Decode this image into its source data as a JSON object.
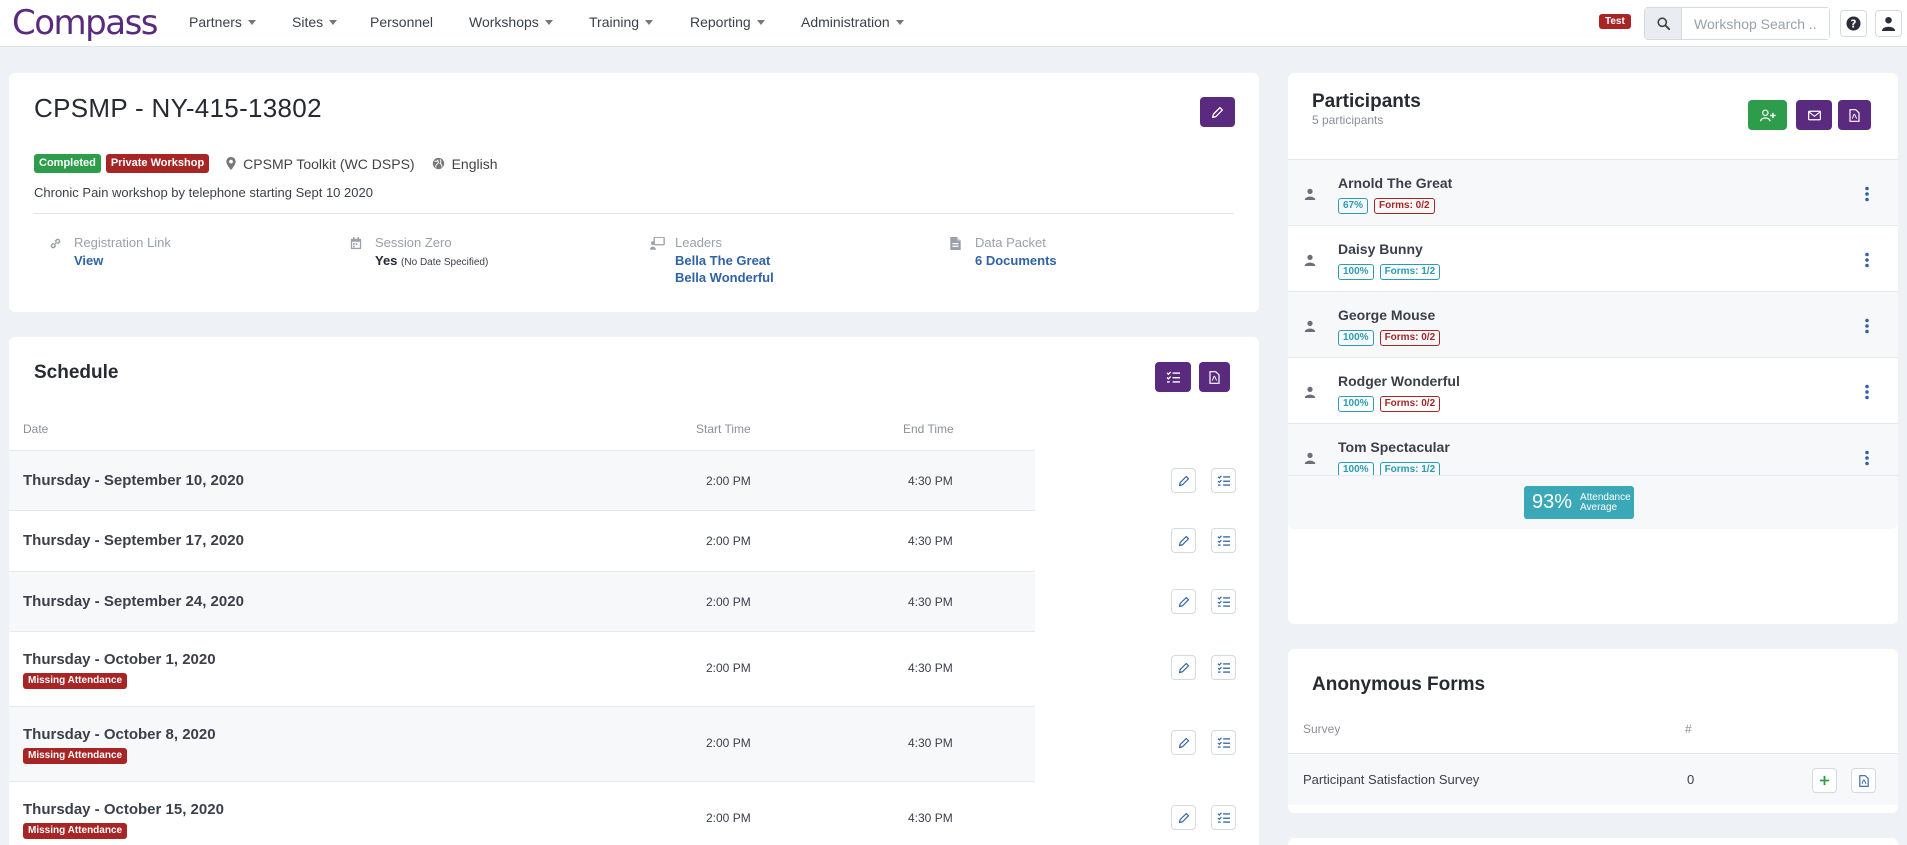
{
  "header": {
    "logo": "Compass",
    "nav": [
      {
        "label": "Partners",
        "dropdown": true
      },
      {
        "label": "Sites",
        "dropdown": true
      },
      {
        "label": "Personnel",
        "dropdown": false
      },
      {
        "label": "Workshops",
        "dropdown": true
      },
      {
        "label": "Training",
        "dropdown": true
      },
      {
        "label": "Reporting",
        "dropdown": true
      },
      {
        "label": "Administration",
        "dropdown": true
      }
    ],
    "env_badge": "Test",
    "search_placeholder": "Workshop Search ..."
  },
  "workshop": {
    "title": "CPSMP - NY-415-13802",
    "status": "Completed",
    "type_badge": "Private Workshop",
    "location": "CPSMP Toolkit (WC DSPS)",
    "language": "English",
    "description": "Chronic Pain workshop by telephone starting Sept 10 2020",
    "registration": {
      "label": "Registration Link",
      "value": "View"
    },
    "session_zero": {
      "label": "Session Zero",
      "value": "Yes",
      "note": "(No Date Specified)"
    },
    "leaders": {
      "label": "Leaders",
      "names": [
        "Bella The Great",
        "Bella Wonderful"
      ]
    },
    "data_packet": {
      "label": "Data Packet",
      "value": "6 Documents"
    }
  },
  "schedule": {
    "title": "Schedule",
    "columns": [
      "Date",
      "Start Time",
      "End Time"
    ],
    "rows": [
      {
        "date": "Thursday - September 10, 2020",
        "start": "2:00 PM",
        "end": "4:30 PM",
        "badge": ""
      },
      {
        "date": "Thursday - September 17, 2020",
        "start": "2:00 PM",
        "end": "4:30 PM",
        "badge": ""
      },
      {
        "date": "Thursday - September 24, 2020",
        "start": "2:00 PM",
        "end": "4:30 PM",
        "badge": ""
      },
      {
        "date": "Thursday - October 1, 2020",
        "start": "2:00 PM",
        "end": "4:30 PM",
        "badge": "Missing Attendance"
      },
      {
        "date": "Thursday - October 8, 2020",
        "start": "2:00 PM",
        "end": "4:30 PM",
        "badge": "Missing Attendance"
      },
      {
        "date": "Thursday - October 15, 2020",
        "start": "2:00 PM",
        "end": "4:30 PM",
        "badge": "Missing Attendance"
      }
    ]
  },
  "participants": {
    "title": "Participants",
    "count_label": "5 participants",
    "items": [
      {
        "name": "Arnold The Great",
        "attendance": "67%",
        "forms": "Forms: 0/2",
        "forms_status": "incomplete"
      },
      {
        "name": "Daisy Bunny",
        "attendance": "100%",
        "forms": "Forms: 1/2",
        "forms_status": "partial"
      },
      {
        "name": "George Mouse",
        "attendance": "100%",
        "forms": "Forms: 0/2",
        "forms_status": "incomplete"
      },
      {
        "name": "Rodger Wonderful",
        "attendance": "100%",
        "forms": "Forms: 0/2",
        "forms_status": "incomplete"
      },
      {
        "name": "Tom Spectacular",
        "attendance": "100%",
        "forms": "Forms: 1/2",
        "forms_status": "partial"
      }
    ],
    "average_value": "93%",
    "average_label_1": "Attendance",
    "average_label_2": "Average"
  },
  "anonymous_forms": {
    "title": "Anonymous Forms",
    "columns": [
      "Survey",
      "#"
    ],
    "rows": [
      {
        "survey": "Participant Satisfaction Survey",
        "count": "0"
      }
    ]
  },
  "colors": {
    "brand_purple": "#5a2a7e",
    "success_green": "#2e9d4b",
    "danger_red": "#a82525",
    "teal": "#2a9cb3",
    "link_blue": "#2f62a6"
  }
}
